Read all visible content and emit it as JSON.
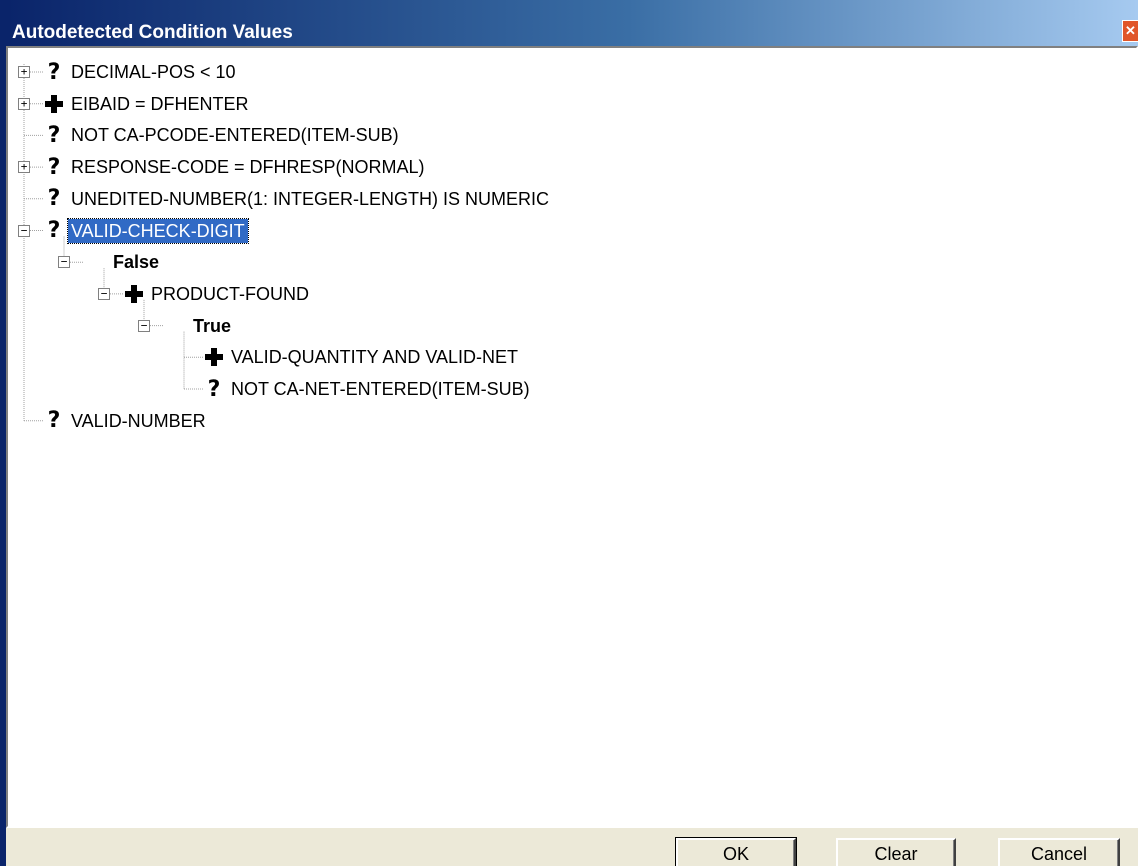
{
  "window": {
    "title": "Autodetected Condition Values",
    "close_label": "✕"
  },
  "tree": [
    {
      "level": 0,
      "expander": "+",
      "icon": "question-icon",
      "label": "DECIMAL-POS < 10",
      "bold": false,
      "selected": false
    },
    {
      "level": 0,
      "expander": "+",
      "icon": "plus-icon",
      "label": "EIBAID = DFHENTER",
      "bold": false,
      "selected": false
    },
    {
      "level": 0,
      "expander": "",
      "icon": "question-icon",
      "label": "NOT CA-PCODE-ENTERED(ITEM-SUB)",
      "bold": false,
      "selected": false
    },
    {
      "level": 0,
      "expander": "+",
      "icon": "question-icon",
      "label": "RESPONSE-CODE = DFHRESP(NORMAL)",
      "bold": false,
      "selected": false
    },
    {
      "level": 0,
      "expander": "",
      "icon": "question-icon",
      "label": "UNEDITED-NUMBER(1: INTEGER-LENGTH) IS NUMERIC",
      "bold": false,
      "selected": false
    },
    {
      "level": 0,
      "expander": "−",
      "icon": "question-icon",
      "label": "VALID-CHECK-DIGIT",
      "bold": false,
      "selected": true
    },
    {
      "level": 1,
      "expander": "−",
      "icon": "",
      "label": "False",
      "bold": true,
      "selected": false
    },
    {
      "level": 2,
      "expander": "−",
      "icon": "plus-icon",
      "label": "PRODUCT-FOUND",
      "bold": false,
      "selected": false
    },
    {
      "level": 3,
      "expander": "−",
      "icon": "",
      "label": "True",
      "bold": true,
      "selected": false
    },
    {
      "level": 4,
      "expander": "",
      "icon": "plus-icon",
      "label": "VALID-QUANTITY AND VALID-NET",
      "bold": false,
      "selected": false
    },
    {
      "level": 4,
      "expander": "",
      "icon": "question-icon",
      "label": "NOT CA-NET-ENTERED(ITEM-SUB)",
      "bold": false,
      "selected": false
    },
    {
      "level": 0,
      "expander": "",
      "icon": "question-icon",
      "label": "VALID-NUMBER",
      "bold": false,
      "selected": false
    }
  ],
  "buttons": {
    "ok": "OK",
    "clear": "Clear",
    "cancel": "Cancel"
  },
  "colors": {
    "selection": "#316ac5",
    "title_start": "#0a246a",
    "title_end": "#a6caf0"
  }
}
